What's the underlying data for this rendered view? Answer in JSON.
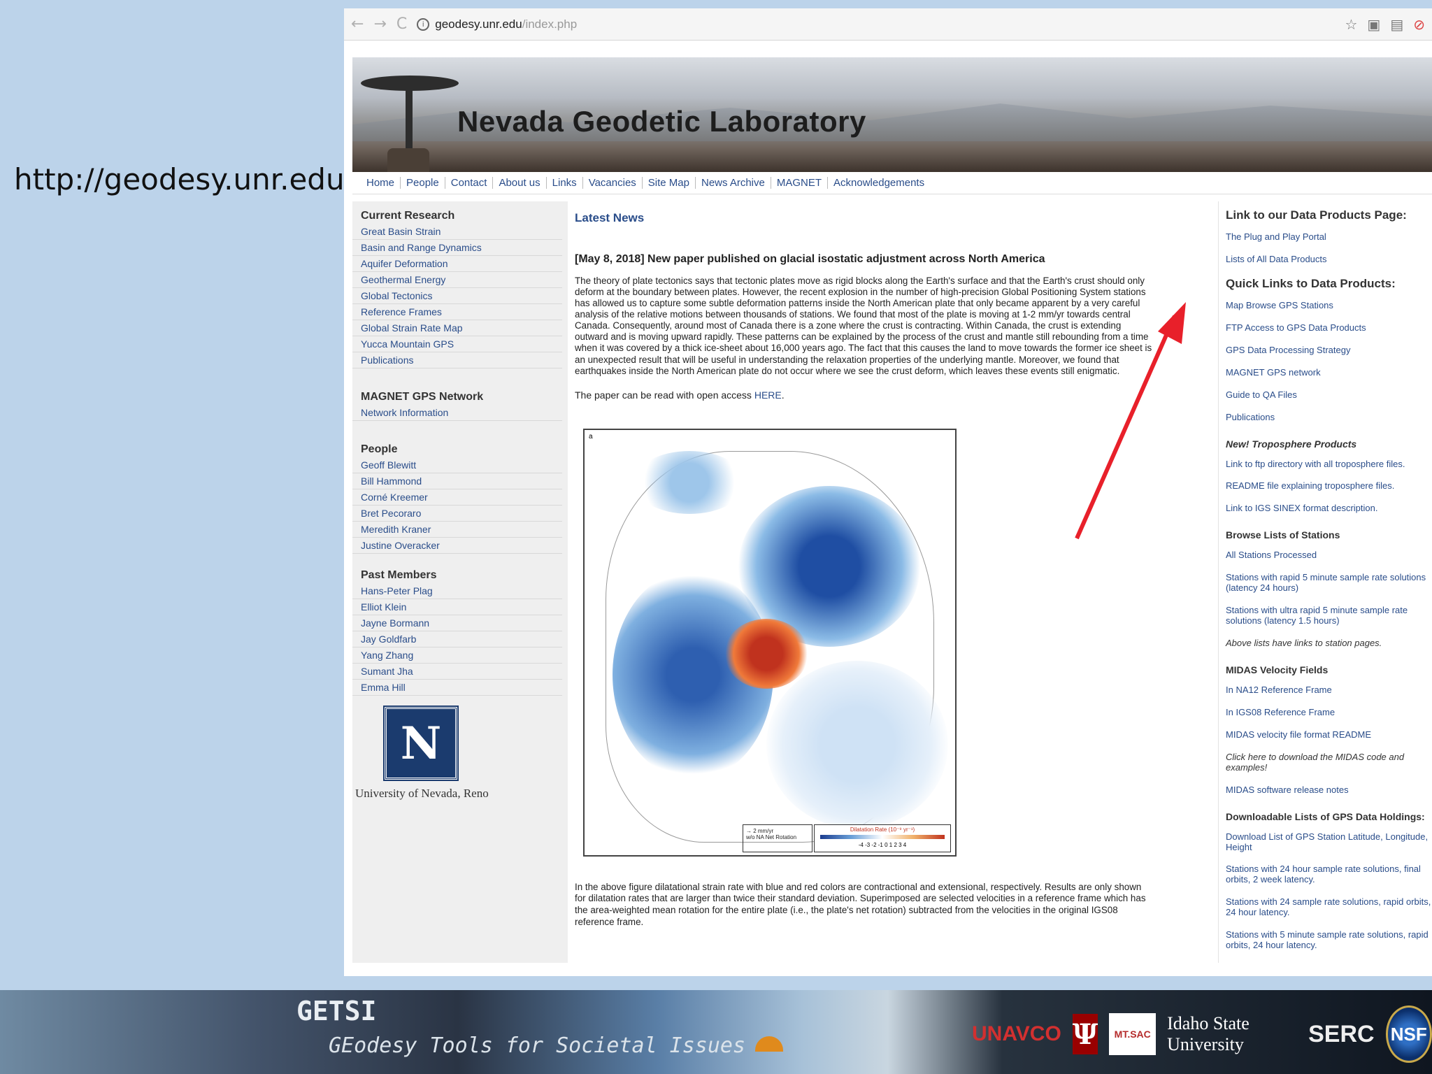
{
  "slide": {
    "url_text": "http://geodesy.unr.edu/"
  },
  "browser": {
    "back": "←",
    "forward": "→",
    "reload": "C",
    "address_host": "geodesy.unr.edu",
    "address_path": "/index.php",
    "icons": [
      "star-icon",
      "extension-icon",
      "extension-icon",
      "stop-icon"
    ]
  },
  "site": {
    "banner_title": "Nevada Geodetic Laboratory",
    "nav": [
      "Home",
      "People",
      "Contact",
      "About us",
      "Links",
      "Vacancies",
      "Site Map",
      "News Archive",
      "MAGNET",
      "Acknowledgements"
    ]
  },
  "left": {
    "current_research_title": "Current Research",
    "current_research": [
      "Great Basin Strain",
      "Basin and Range Dynamics",
      "Aquifer Deformation",
      "Geothermal Energy",
      "Global Tectonics",
      "Reference Frames",
      "Global Strain Rate Map",
      "Yucca Mountain GPS",
      "Publications"
    ],
    "magnet_title": "MAGNET GPS Network",
    "magnet": [
      "Network Information"
    ],
    "people_title": "People",
    "people": [
      "Geoff Blewitt",
      "Bill Hammond",
      "Corné Kreemer",
      "Bret Pecoraro",
      "Meredith Kraner",
      "Justine Overacker"
    ],
    "past_title": "Past Members",
    "past": [
      "Hans-Peter Plag",
      "Elliot Klein",
      "Jayne Bormann",
      "Jay Goldfarb",
      "Yang Zhang",
      "Sumant Jha",
      "Emma Hill"
    ],
    "logo_letter": "N",
    "university": "University of Nevada, Reno"
  },
  "main": {
    "latest_news": "Latest News",
    "headline": "[May 8, 2018] New paper published on glacial isostatic adjustment across North America",
    "paragraph": "The theory of plate tectonics says that tectonic plates move as rigid blocks along the Earth's surface and that the Earth's crust should only deform at the boundary between plates. However, the recent explosion in the number of high-precision Global Positioning System stations has allowed us to capture some subtle deformation patterns inside the North American plate that only became apparent by a very careful analysis of the relative motions between thousands of stations. We found that most of the plate is moving at 1-2 mm/yr towards central Canada. Consequently, around most of Canada there is a zone where the crust is contracting. Within Canada, the crust is extending outward and is moving upward rapidly. These patterns can be explained by the process of the crust and mantle still rebounding from a time when it was covered by a thick ice-sheet about 16,000 years ago. The fact that this causes the land to move towards the former ice sheet is an unexpected result that will be useful in understanding the relaxation properties of the underlying mantle. Moreover, we found that earthquakes inside the North American plate do not occur where we see the crust deform, which leaves these events still enigmatic.",
    "paper_prefix": "The paper can be read with open access ",
    "paper_link": "HERE",
    "paper_suffix": ".",
    "map_corner": "a",
    "map_scale": "→ 2 mm/yr",
    "map_scale_sub": "w/o NA Net Rotation",
    "map_legend_title": "Dilatation Rate (10⁻⁹ yr⁻¹)",
    "map_legend_ticks": "-4 -3 -2 -1 0 1 2 3 4",
    "caption": "In the above figure dilatational strain rate with blue and red colors are contractional and extensional, respectively. Results are only shown for dilatation rates that are larger than twice their standard deviation. Superimposed are selected velocities in a reference frame which has the area-weighted mean rotation for the entire plate (i.e., the plate's net rotation) subtracted from the velocities in the original IGS08 reference frame."
  },
  "right": {
    "data_products_title": "Link to our Data Products Page:",
    "data_products": [
      "The Plug and Play Portal",
      "Lists of All Data Products"
    ],
    "quick_title": "Quick Links to Data Products:",
    "quick": [
      "Map Browse GPS Stations",
      "FTP Access to GPS Data Products",
      "GPS Data Processing Strategy",
      "MAGNET GPS network",
      "Guide to QA Files",
      "Publications"
    ],
    "tropo_title": "New! Troposphere Products",
    "tropo": [
      "Link to ftp directory with all troposphere files.",
      "README file explaining troposphere files.",
      "Link to IGS SINEX format description."
    ],
    "browse_title": "Browse Lists of Stations",
    "browse": [
      "All Stations Processed",
      "Stations with rapid 5 minute sample rate solutions (latency 24 hours)",
      "Stations with ultra rapid 5 minute sample rate solutions (latency 1.5 hours)"
    ],
    "browse_note": "Above lists have links to station pages.",
    "midas_title": "MIDAS Velocity Fields",
    "midas": [
      "In NA12 Reference Frame",
      "In IGS08 Reference Frame",
      "MIDAS velocity file format README"
    ],
    "midas_note": "Click here to download the MIDAS code and examples!",
    "midas_release": "MIDAS software release notes",
    "download_title": "Downloadable Lists of GPS Data Holdings:",
    "download": [
      "Download List of GPS Station Latitude, Longitude, Height",
      "Stations with 24 hour sample rate solutions, final orbits, 2 week latency.",
      "Stations with 24 sample rate solutions, rapid orbits, 24 hour latency.",
      "Stations with 5 minute sample rate solutions, rapid orbits, 24 hour latency."
    ]
  },
  "footer": {
    "getsi": "GETSI",
    "getsi_sub": "GEodesy Tools for Societal Issues",
    "unavco": "UNAVCO",
    "iu": "Ψ",
    "mtsac": "MT.SAC",
    "idaho": "Idaho State University",
    "serc": "SERC",
    "nsf": "NSF"
  },
  "colors": {
    "link": "#2a4d8a",
    "arrow": "#e8202a",
    "slide_bg": "#bcd3ea"
  }
}
